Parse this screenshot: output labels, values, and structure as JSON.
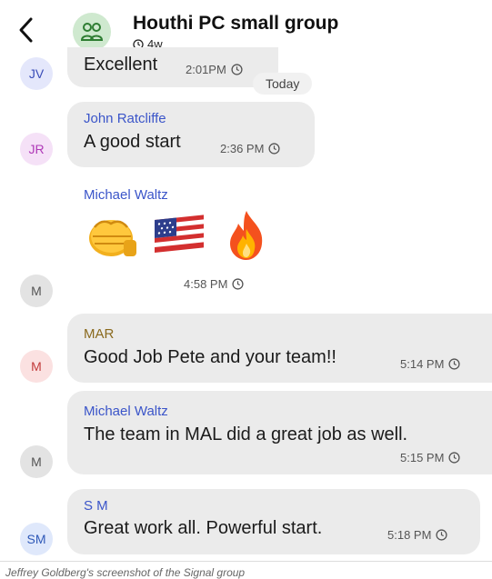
{
  "header": {
    "back_icon": "chevron-left-icon",
    "group_icon": "group-icon",
    "title": "Houthi PC small group",
    "disappearing_timer": "4w"
  },
  "messages": [
    {
      "avatar": "JV",
      "sender": "",
      "text": "Excellent",
      "time": "2:01PM"
    },
    {
      "avatar": "JR",
      "sender": "John Ratcliffe",
      "text": "A good start",
      "time": "2:36 PM"
    },
    {
      "avatar": "M",
      "sender": "Michael Waltz",
      "emojis": [
        "oncoming-fist",
        "us-flag",
        "fire"
      ],
      "time": "4:58 PM"
    },
    {
      "avatar": "M",
      "sender": "MAR",
      "text": "Good Job Pete and your team!!",
      "time": "5:14 PM"
    },
    {
      "avatar": "M",
      "sender": "Michael Waltz",
      "text": "The team in MAL did a great job  as well.",
      "time": "5:15 PM"
    },
    {
      "avatar": "SM",
      "sender": "S M",
      "text": "Great work all. Powerful start.",
      "time": "5:18 PM"
    }
  ],
  "date_separator": "Today",
  "caption": "Jeffrey Goldberg's screenshot of the Signal group",
  "colors": {
    "bubble": "#ebebeb",
    "sender_blue": "#3b55c9",
    "sender_gold": "#8a6a1e",
    "group_avatar_bg": "#cfe9cf"
  }
}
